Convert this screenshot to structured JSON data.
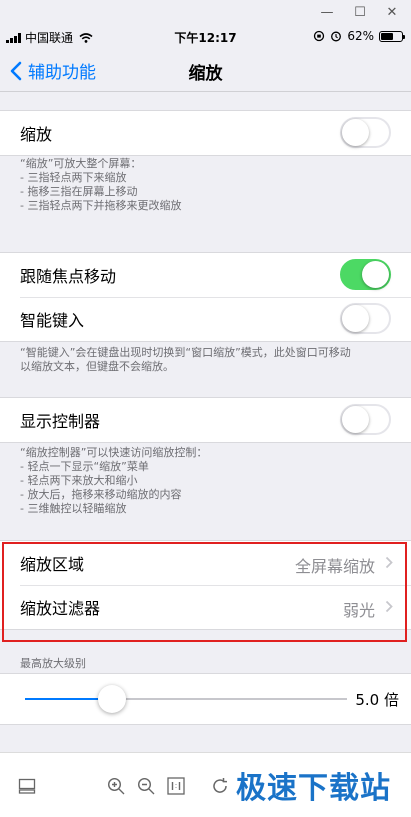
{
  "status_bar": {
    "carrier": "中国联通",
    "time": "下午12:17",
    "battery": "62%",
    "battery_level": 0.62
  },
  "nav": {
    "back_label": "辅助功能",
    "title": "缩放"
  },
  "zoom": {
    "label": "缩放",
    "on": false,
    "notes": [
      "“缩放”可放大整个屏幕：",
      "- 三指轻点两下来缩放",
      "- 拖移三指在屏幕上移动",
      "- 三指轻点两下并拖移来更改缩放"
    ]
  },
  "focus": {
    "follow_label": "跟随焦点移动",
    "follow_on": true,
    "smart_label": "智能键入",
    "smart_on": false,
    "notes": [
      "“智能键入”会在键盘出现时切换到“窗口缩放”模式，此处窗口可移动",
      "以缩放文本，但键盘不会缩放。"
    ]
  },
  "controller": {
    "label": "显示控制器",
    "on": false,
    "notes": [
      "“缩放控制器”可以快速访问缩放控制：",
      "- 轻点一下显示“缩放”菜单",
      "- 轻点两下来放大和缩小",
      "- 放大后，拖移来移动缩放的内容",
      "- 三维触控以轻瞄缩放"
    ]
  },
  "region": {
    "region_label": "缩放区域",
    "region_value": "全屏幕缩放",
    "filter_label": "缩放过滤器",
    "filter_value": "弱光"
  },
  "max_zoom": {
    "header": "最高放大级别",
    "value_label": "5.0 倍",
    "level": 0.27
  },
  "toolbar": {
    "watermark": "极速下载站"
  },
  "colors": {
    "accent": "#007aff",
    "toggle_on": "#4cd964",
    "highlight_box": "#e02020"
  }
}
